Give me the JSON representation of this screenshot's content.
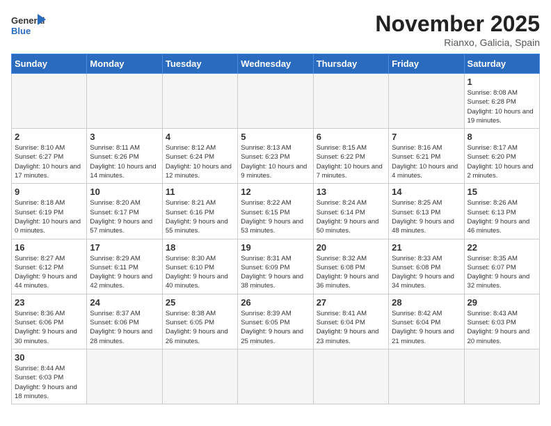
{
  "header": {
    "logo_general": "General",
    "logo_blue": "Blue",
    "month_title": "November 2025",
    "location": "Rianxo, Galicia, Spain"
  },
  "weekdays": [
    "Sunday",
    "Monday",
    "Tuesday",
    "Wednesday",
    "Thursday",
    "Friday",
    "Saturday"
  ],
  "days": [
    {
      "date": null,
      "info": ""
    },
    {
      "date": null,
      "info": ""
    },
    {
      "date": null,
      "info": ""
    },
    {
      "date": null,
      "info": ""
    },
    {
      "date": null,
      "info": ""
    },
    {
      "date": null,
      "info": ""
    },
    {
      "date": "1",
      "info": "Sunrise: 8:08 AM\nSunset: 6:28 PM\nDaylight: 10 hours and 19 minutes."
    },
    {
      "date": "2",
      "info": "Sunrise: 8:10 AM\nSunset: 6:27 PM\nDaylight: 10 hours and 17 minutes."
    },
    {
      "date": "3",
      "info": "Sunrise: 8:11 AM\nSunset: 6:26 PM\nDaylight: 10 hours and 14 minutes."
    },
    {
      "date": "4",
      "info": "Sunrise: 8:12 AM\nSunset: 6:24 PM\nDaylight: 10 hours and 12 minutes."
    },
    {
      "date": "5",
      "info": "Sunrise: 8:13 AM\nSunset: 6:23 PM\nDaylight: 10 hours and 9 minutes."
    },
    {
      "date": "6",
      "info": "Sunrise: 8:15 AM\nSunset: 6:22 PM\nDaylight: 10 hours and 7 minutes."
    },
    {
      "date": "7",
      "info": "Sunrise: 8:16 AM\nSunset: 6:21 PM\nDaylight: 10 hours and 4 minutes."
    },
    {
      "date": "8",
      "info": "Sunrise: 8:17 AM\nSunset: 6:20 PM\nDaylight: 10 hours and 2 minutes."
    },
    {
      "date": "9",
      "info": "Sunrise: 8:18 AM\nSunset: 6:19 PM\nDaylight: 10 hours and 0 minutes."
    },
    {
      "date": "10",
      "info": "Sunrise: 8:20 AM\nSunset: 6:17 PM\nDaylight: 9 hours and 57 minutes."
    },
    {
      "date": "11",
      "info": "Sunrise: 8:21 AM\nSunset: 6:16 PM\nDaylight: 9 hours and 55 minutes."
    },
    {
      "date": "12",
      "info": "Sunrise: 8:22 AM\nSunset: 6:15 PM\nDaylight: 9 hours and 53 minutes."
    },
    {
      "date": "13",
      "info": "Sunrise: 8:24 AM\nSunset: 6:14 PM\nDaylight: 9 hours and 50 minutes."
    },
    {
      "date": "14",
      "info": "Sunrise: 8:25 AM\nSunset: 6:13 PM\nDaylight: 9 hours and 48 minutes."
    },
    {
      "date": "15",
      "info": "Sunrise: 8:26 AM\nSunset: 6:13 PM\nDaylight: 9 hours and 46 minutes."
    },
    {
      "date": "16",
      "info": "Sunrise: 8:27 AM\nSunset: 6:12 PM\nDaylight: 9 hours and 44 minutes."
    },
    {
      "date": "17",
      "info": "Sunrise: 8:29 AM\nSunset: 6:11 PM\nDaylight: 9 hours and 42 minutes."
    },
    {
      "date": "18",
      "info": "Sunrise: 8:30 AM\nSunset: 6:10 PM\nDaylight: 9 hours and 40 minutes."
    },
    {
      "date": "19",
      "info": "Sunrise: 8:31 AM\nSunset: 6:09 PM\nDaylight: 9 hours and 38 minutes."
    },
    {
      "date": "20",
      "info": "Sunrise: 8:32 AM\nSunset: 6:08 PM\nDaylight: 9 hours and 36 minutes."
    },
    {
      "date": "21",
      "info": "Sunrise: 8:33 AM\nSunset: 6:08 PM\nDaylight: 9 hours and 34 minutes."
    },
    {
      "date": "22",
      "info": "Sunrise: 8:35 AM\nSunset: 6:07 PM\nDaylight: 9 hours and 32 minutes."
    },
    {
      "date": "23",
      "info": "Sunrise: 8:36 AM\nSunset: 6:06 PM\nDaylight: 9 hours and 30 minutes."
    },
    {
      "date": "24",
      "info": "Sunrise: 8:37 AM\nSunset: 6:06 PM\nDaylight: 9 hours and 28 minutes."
    },
    {
      "date": "25",
      "info": "Sunrise: 8:38 AM\nSunset: 6:05 PM\nDaylight: 9 hours and 26 minutes."
    },
    {
      "date": "26",
      "info": "Sunrise: 8:39 AM\nSunset: 6:05 PM\nDaylight: 9 hours and 25 minutes."
    },
    {
      "date": "27",
      "info": "Sunrise: 8:41 AM\nSunset: 6:04 PM\nDaylight: 9 hours and 23 minutes."
    },
    {
      "date": "28",
      "info": "Sunrise: 8:42 AM\nSunset: 6:04 PM\nDaylight: 9 hours and 21 minutes."
    },
    {
      "date": "29",
      "info": "Sunrise: 8:43 AM\nSunset: 6:03 PM\nDaylight: 9 hours and 20 minutes."
    },
    {
      "date": "30",
      "info": "Sunrise: 8:44 AM\nSunset: 6:03 PM\nDaylight: 9 hours and 18 minutes."
    },
    {
      "date": null,
      "info": ""
    },
    {
      "date": null,
      "info": ""
    },
    {
      "date": null,
      "info": ""
    },
    {
      "date": null,
      "info": ""
    },
    {
      "date": null,
      "info": ""
    },
    {
      "date": null,
      "info": ""
    }
  ]
}
